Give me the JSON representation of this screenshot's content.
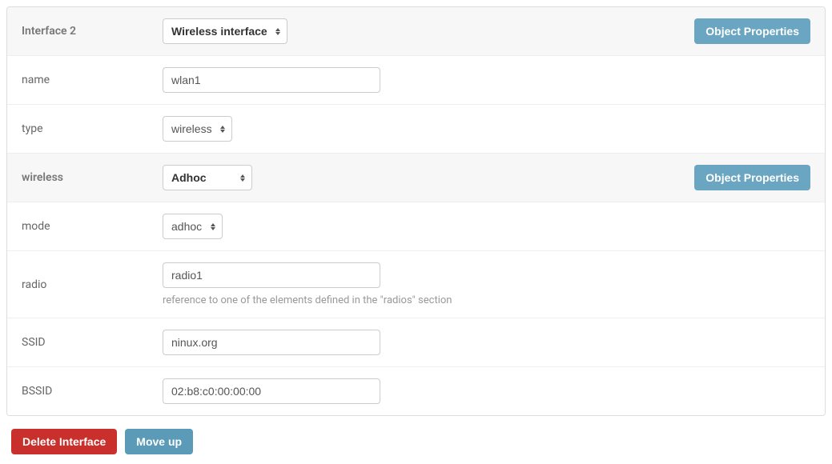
{
  "interface_header": {
    "title": "Interface 2",
    "select": "Wireless interface",
    "button": "Object Properties"
  },
  "fields": {
    "name": {
      "label": "name",
      "value": "wlan1"
    },
    "type": {
      "label": "type",
      "value": "wireless"
    }
  },
  "wireless_header": {
    "title": "wireless",
    "select": "Adhoc",
    "button": "Object Properties"
  },
  "wireless": {
    "mode": {
      "label": "mode",
      "value": "adhoc"
    },
    "radio": {
      "label": "radio",
      "value": "radio1",
      "help": "reference to one of the elements defined in the \"radios\" section"
    },
    "ssid": {
      "label": "SSID",
      "value": "ninux.org"
    },
    "bssid": {
      "label": "BSSID",
      "value": "02:b8:c0:00:00:00"
    }
  },
  "actions": {
    "delete": "Delete Interface",
    "moveup": "Move up"
  }
}
